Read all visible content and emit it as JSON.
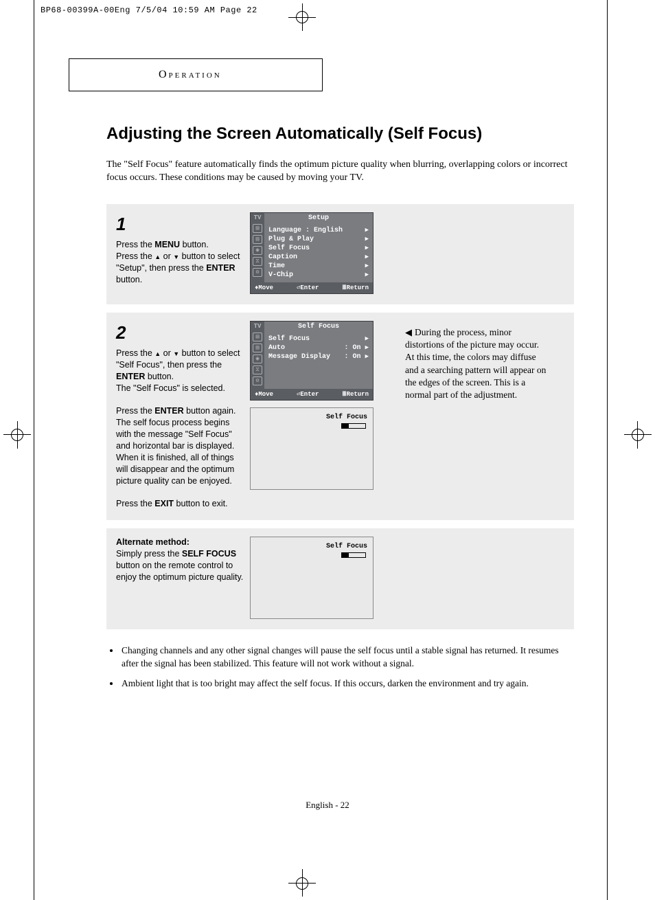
{
  "slug": "BP68-00399A-00Eng  7/5/04  10:59 AM  Page 22",
  "section_tab": "Operation",
  "title": "Adjusting the Screen Automatically (Self Focus)",
  "intro": "The \"Self Focus\" feature automatically finds the optimum picture quality when blurring, overlapping colors or incorrect focus occurs. These conditions may be caused by moving your TV.",
  "step1": {
    "num": "1",
    "p1a": "Press the ",
    "p1b": "MENU",
    "p1c": " button.",
    "p2a": "Press the ",
    "p2b": " or ",
    "p2c": " button to select \"Setup\", then press the ",
    "p2d": "ENTER",
    "p2e": " button."
  },
  "step2": {
    "num": "2",
    "p1a": "Press the ",
    "p1b": " or ",
    "p1c": " button to select \"Self Focus\", then press the ",
    "p1d": "ENTER",
    "p1e": " button.",
    "p2": "The \"Self Focus\" is selected.",
    "p3a": "Press the ",
    "p3b": "ENTER",
    "p3c": " button again.",
    "p4": "The self focus process begins with the message \"Self Focus\" and horizontal bar is displayed.",
    "p5": "When it is finished, all of things will disappear and the optimum picture quality can be enjoyed.",
    "p6a": "Press the ",
    "p6b": "EXIT",
    "p6c": " button to exit."
  },
  "alt": {
    "heading": "Alternate method:",
    "p1a": "Simply press the ",
    "p1b": "SELF FOCUS",
    "p1c": " button on the remote control to enjoy the optimum picture quality."
  },
  "osd_setup": {
    "tab": "TV",
    "title": "Setup",
    "items": [
      {
        "label": "Language",
        "value": ": English"
      },
      {
        "label": "Plug & Play",
        "value": ""
      },
      {
        "label": "Self Focus",
        "value": ""
      },
      {
        "label": "Caption",
        "value": ""
      },
      {
        "label": "Time",
        "value": ""
      },
      {
        "label": "V-Chip",
        "value": ""
      }
    ],
    "footer": {
      "move": "Move",
      "enter": "Enter",
      "return": "Return"
    }
  },
  "osd_selffocus": {
    "tab": "TV",
    "title": "Self Focus",
    "items": [
      {
        "label": "Self Focus",
        "value": ""
      },
      {
        "label": "Auto",
        "value": ": On"
      },
      {
        "label": "Message Display",
        "value": ": On"
      }
    ],
    "footer": {
      "move": "Move",
      "enter": "Enter",
      "return": "Return"
    }
  },
  "sf_overlay": "Self Focus",
  "side_note": "During the process, minor distortions of the picture may occur. At this time, the colors may diffuse and a searching pattern will appear on the edges of the screen. This is a normal part of the adjustment.",
  "bullets": [
    "Changing channels and any other signal changes will pause the self focus until a stable signal has returned. It resumes after the signal has been stabilized. This feature will not work without a signal.",
    "Ambient light that is too bright may affect the self focus. If this occurs, darken the environment and try again."
  ],
  "footer_page": "English - 22"
}
